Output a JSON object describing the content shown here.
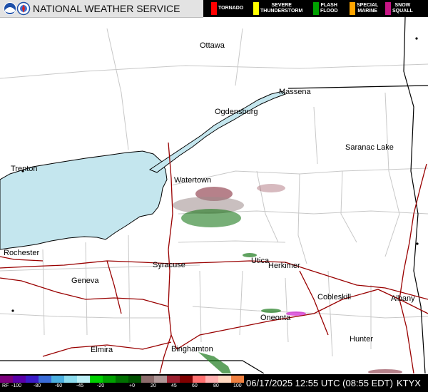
{
  "header": {
    "title": "NATIONAL WEATHER SERVICE",
    "warnings": [
      {
        "label": "TORNADO",
        "color": "#ff0000"
      },
      {
        "label": "SEVERE\nTHUNDERSTORM",
        "color": "#ffff00"
      },
      {
        "label": "FLASH\nFLOOD",
        "color": "#00a000"
      },
      {
        "label": "SPECIAL\nMARINE",
        "color": "#ffa500"
      },
      {
        "label": "SNOW\nSQUALL",
        "color": "#c71585"
      }
    ]
  },
  "map": {
    "places": [
      "Ottawa",
      "Massena",
      "Ogdensburg",
      "Saranac Lake",
      "Trenton",
      "Watertown",
      "Rochester",
      "Syracuse",
      "Utica",
      "Herkimer",
      "Geneva",
      "Cobleskill",
      "Albany",
      "Oneonta",
      "Hunter",
      "Elmira",
      "Binghamton"
    ],
    "colors": {
      "water": "#c4e6ee",
      "highway": "#990000",
      "border": "#000000",
      "county": "#c8c8c8"
    }
  },
  "scale": {
    "label": "RF",
    "ticks": [
      "-100",
      "-80",
      "-60",
      "-45",
      "-20",
      "+0",
      "20",
      "45",
      "60",
      "80",
      "100"
    ],
    "colors": [
      "#7c007c",
      "#5a00a8",
      "#3c1cc8",
      "#3a6cd8",
      "#4cb0e0",
      "#8cdcee",
      "#bcf0f6",
      "#00d000",
      "#00a000",
      "#007000",
      "#005000",
      "#8c6c6c",
      "#b09898",
      "#9c2030",
      "#800000",
      "#ff7070",
      "#ffb0b0",
      "#ffd8c0",
      "#f08040"
    ]
  },
  "footer": {
    "timestamp": "06/17/2025 12:55 UTC (08:55 EDT)",
    "station": "KTYX"
  }
}
